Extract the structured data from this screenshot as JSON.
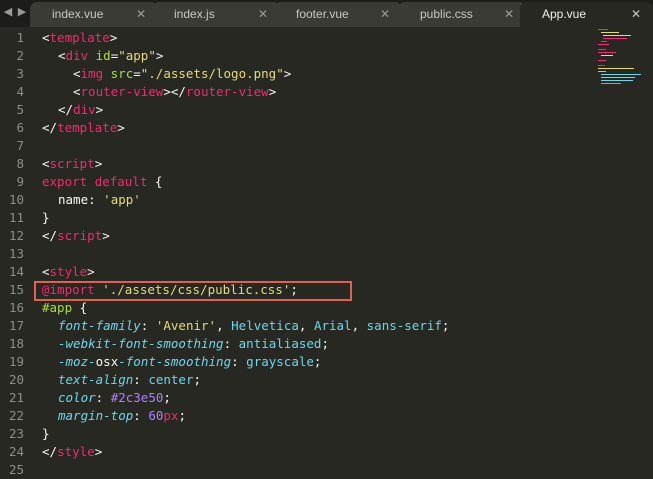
{
  "nav": {
    "left": "◀",
    "right": "▶"
  },
  "tabs": [
    {
      "label": "index.vue",
      "active": false
    },
    {
      "label": "index.js",
      "active": false
    },
    {
      "label": "footer.vue",
      "active": false
    },
    {
      "label": "public.css",
      "active": false
    },
    {
      "label": "App.vue",
      "active": true
    }
  ],
  "close_glyph": "✕",
  "line_numbers": [
    "1",
    "2",
    "3",
    "4",
    "5",
    "6",
    "7",
    "8",
    "9",
    "10",
    "11",
    "12",
    "13",
    "14",
    "15",
    "16",
    "17",
    "18",
    "19",
    "20",
    "21",
    "22",
    "23",
    "24",
    "25"
  ],
  "code": {
    "l1": [
      "<",
      "template",
      ">"
    ],
    "l2": [
      "<",
      "div",
      " ",
      "id",
      "=",
      "\"app\"",
      ">"
    ],
    "l3": [
      "<",
      "img",
      " ",
      "src",
      "=",
      "\"./assets/logo.png\"",
      ">"
    ],
    "l4": [
      "<",
      "router-view",
      "></",
      "router-view",
      ">"
    ],
    "l5": [
      "</",
      "div",
      ">"
    ],
    "l6": [
      "</",
      "template",
      ">"
    ],
    "l8": [
      "<",
      "script",
      ">"
    ],
    "l9": [
      "export",
      " ",
      "default",
      " {"
    ],
    "l10": [
      "name",
      ": ",
      "'app'"
    ],
    "l11": [
      "}"
    ],
    "l12": [
      "</",
      "script",
      ">"
    ],
    "l14": [
      "<",
      "style",
      ">"
    ],
    "l15": [
      "@import",
      " ",
      "'./assets/css/public.css'",
      ";"
    ],
    "l16": [
      "#app",
      " {"
    ],
    "l17": [
      "font-family",
      ": ",
      "'Avenir'",
      ", ",
      "Helvetica",
      ", ",
      "Arial",
      ", ",
      "sans-serif",
      ";"
    ],
    "l18": [
      "-webkit-font-smoothing",
      ": ",
      "antialiased",
      ";"
    ],
    "l19": [
      "-moz-",
      "osx",
      "-font-smoothing",
      ": ",
      "grayscale",
      ";"
    ],
    "l20": [
      "text-align",
      ": ",
      "center",
      ";"
    ],
    "l21": [
      "color",
      ": ",
      "#2c3e50",
      ";"
    ],
    "l22": [
      "margin-top",
      ": ",
      "60",
      "px",
      ";"
    ],
    "l23": [
      "}"
    ],
    "l24": [
      "</",
      "style",
      ">"
    ]
  },
  "colors": {
    "background": "#272822",
    "tag": "#f92672",
    "string": "#e6db74",
    "attribute": "#a6e22e",
    "property": "#66d9ef",
    "number": "#ae81ff",
    "highlight_border": "#e0614e"
  }
}
